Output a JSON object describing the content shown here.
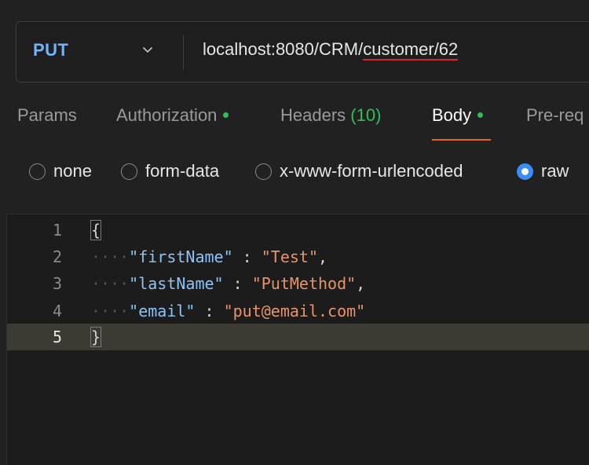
{
  "request": {
    "method": "PUT",
    "url_prefix": "localhost:8080/CRM/",
    "url_path": "customer/62"
  },
  "tabs": [
    {
      "label": "Params",
      "has_dot": false
    },
    {
      "label": "Authorization",
      "has_dot": true
    },
    {
      "label": "Headers",
      "count": "(10)",
      "has_dot": false
    },
    {
      "label": "Body",
      "has_dot": true,
      "active": true
    },
    {
      "label": "Pre-req",
      "has_dot": false
    }
  ],
  "body_types": [
    {
      "label": "none",
      "checked": false
    },
    {
      "label": "form-data",
      "checked": false
    },
    {
      "label": "x-www-form-urlencoded",
      "checked": false
    },
    {
      "label": "raw",
      "checked": true
    }
  ],
  "editor": {
    "lines": [
      {
        "num": "1",
        "open": "{"
      },
      {
        "num": "2",
        "key": "\"firstName\"",
        "sep": " : ",
        "value": "\"Test\"",
        "trail": ","
      },
      {
        "num": "3",
        "key": "\"lastName\"",
        "sep": " : ",
        "value": "\"PutMethod\"",
        "trail": ","
      },
      {
        "num": "4",
        "key": "\"email\"",
        "sep": " : ",
        "value": "\"put@email.com\"",
        "trail": ""
      },
      {
        "num": "5",
        "close": "}"
      }
    ]
  },
  "colors": {
    "method": "#6bb6ff",
    "status_dot": "#2fbf57",
    "active_underline": "#e8622c",
    "radio_checked": "#3b8cf5",
    "json_key": "#8ec3f5",
    "json_string": "#e8946a"
  }
}
